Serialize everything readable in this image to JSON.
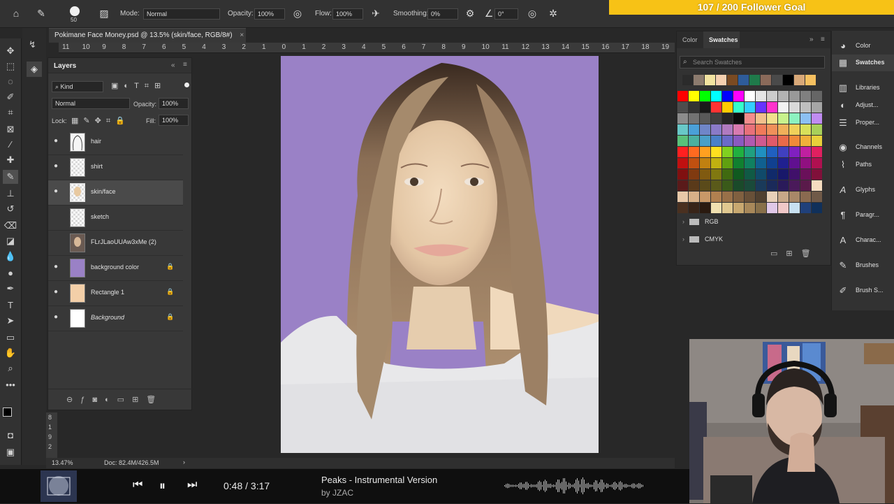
{
  "goal": {
    "text": "107 / 200 Follower Goal"
  },
  "options_bar": {
    "brush_size": "50",
    "mode_label": "Mode:",
    "mode_value": "Normal",
    "opacity_label": "Opacity:",
    "opacity_value": "100%",
    "flow_label": "Flow:",
    "flow_value": "100%",
    "smoothing_label": "Smoothing:",
    "smoothing_value": "0%",
    "angle_value": "0°"
  },
  "document": {
    "tab_title": "Pokimane Face Money.psd @ 13.5% (skin/face, RGB/8#)",
    "close_glyph": "×",
    "ruler_numbers": [
      "11",
      "10",
      "9",
      "8",
      "7",
      "6",
      "5",
      "4",
      "3",
      "2",
      "1",
      "0",
      "1",
      "2",
      "3",
      "4",
      "5",
      "6",
      "7",
      "8",
      "9",
      "10",
      "11",
      "12",
      "13",
      "14",
      "15",
      "16",
      "17",
      "18",
      "19"
    ],
    "vruler_numbers": [
      "8",
      "1",
      "9",
      "2"
    ],
    "zoom": "13.47%",
    "doc_size": "Doc: 82.4M/426.5M"
  },
  "layers_panel": {
    "title": "Layers",
    "kind_label": "Kind",
    "blend_mode": "Normal",
    "opacity_label": "Opacity:",
    "opacity_value": "100%",
    "lock_label": "Lock:",
    "fill_label": "Fill:",
    "fill_value": "100%",
    "layers": [
      {
        "name": "hair",
        "visible": true,
        "locked": false
      },
      {
        "name": "shirt",
        "visible": true,
        "locked": false
      },
      {
        "name": "skin/face",
        "visible": true,
        "locked": false,
        "selected": true
      },
      {
        "name": "sketch",
        "visible": false,
        "locked": false
      },
      {
        "name": "FLrJLaoUUAw3xMe (2)",
        "visible": false,
        "locked": false
      },
      {
        "name": "background color",
        "visible": true,
        "locked": true
      },
      {
        "name": "Rectangle 1",
        "visible": true,
        "locked": true
      },
      {
        "name": "Background",
        "visible": true,
        "locked": true
      }
    ]
  },
  "swatches_panel": {
    "tab_color": "Color",
    "tab_swatches": "Swatches",
    "search_placeholder": "Search Swatches",
    "groups": [
      "RGB",
      "CMYK"
    ],
    "recent": [
      "#2b2b2b",
      "#8c7b6e",
      "#f2e3a0",
      "#f5d0b0",
      "#7a4a22",
      "#2e5c9a",
      "#1f7a4a",
      "#8a6a5a",
      "#4a4a4a",
      "#000000",
      "#d8a878",
      "#f5c060"
    ],
    "grid": [
      "#ff0000",
      "#ffff00",
      "#00ff00",
      "#00ffff",
      "#0000ff",
      "#ff00ff",
      "#ffffff",
      "#e6e6e6",
      "#cccccc",
      "#b3b3b3",
      "#999999",
      "#808080",
      "#666666",
      "#4d4d4d",
      "#333333",
      "#1a1a1a",
      "#ff3333",
      "#ffcc00",
      "#33ffcc",
      "#33ccff",
      "#6633ff",
      "#ff33cc",
      "#f2f2f2",
      "#d9d9d9",
      "#bfbfbf",
      "#a6a6a6",
      "#8c8c8c",
      "#737373",
      "#595959",
      "#404040",
      "#262626",
      "#0d0d0d",
      "#f28c8c",
      "#f2c08c",
      "#f2e08c",
      "#c8f28c",
      "#8cf2c0",
      "#8cc0f2",
      "#c08cf2",
      "#68c8c8",
      "#4aa0d8",
      "#6f86c8",
      "#8a7ac8",
      "#b07ac0",
      "#d87ab0",
      "#e8707a",
      "#f07a5a",
      "#f0905a",
      "#f0b05a",
      "#f0d05a",
      "#d8e05a",
      "#a8d05a",
      "#5ac07a",
      "#4ab0a0",
      "#4aa0c8",
      "#4a80c8",
      "#6a6ac8",
      "#8a5ac0",
      "#b05ab0",
      "#d05a90",
      "#e05a6a",
      "#e86a4a",
      "#f08a3a",
      "#f0b03a",
      "#e8d03a",
      "#ff2020",
      "#ff6a20",
      "#ffa020",
      "#ffe020",
      "#80d020",
      "#20b040",
      "#20a080",
      "#2090c0",
      "#2060c0",
      "#4040c0",
      "#8020c0",
      "#c020a0",
      "#e02060",
      "#c01010",
      "#c05010",
      "#c08010",
      "#c0b010",
      "#60a010",
      "#108030",
      "#108060",
      "#106090",
      "#104090",
      "#202090",
      "#601090",
      "#901080",
      "#b01050",
      "#801010",
      "#803a10",
      "#805a10",
      "#807810",
      "#406a10",
      "#105a20",
      "#105a45",
      "#104a6a",
      "#102a6a",
      "#18186a",
      "#40106a",
      "#6a105a",
      "#80103a",
      "#5a1a1a",
      "#5a3a1a",
      "#5a4a1a",
      "#5a5a1a",
      "#3a5a1a",
      "#1a4a2a",
      "#1a4a3a",
      "#1a3a5a",
      "#1a2a5a",
      "#2a1a5a",
      "#4a1a5a",
      "#5a1a4a",
      "#f5dcc0",
      "#e8c8a8",
      "#d8b088",
      "#c89868",
      "#b08050",
      "#987048",
      "#806040",
      "#685038",
      "#504030",
      "#e8d0b8",
      "#c8a888",
      "#a88868",
      "#8a6a50",
      "#705a48",
      "#4a3020",
      "#382418",
      "#2a1a10",
      "#f0e0b0",
      "#e0c890",
      "#c8a870",
      "#a8885a",
      "#88704a",
      "#e0c8e8",
      "#f0c8c8",
      "#c8e0f0",
      "#20407a",
      "#10305a"
    ]
  },
  "dock": {
    "items": [
      "Color",
      "Swatches",
      "Libraries",
      "Adjust...",
      "Proper...",
      "Channels",
      "Paths",
      "Glyphs",
      "Paragr...",
      "Charac...",
      "Brushes",
      "Brush S..."
    ]
  },
  "media": {
    "time": "0:48 / 3:17",
    "title": "Peaks - Instrumental Version",
    "artist": "by JZAC"
  },
  "colors": {
    "canvas_bg": "#9a81c6",
    "goal_bar": "#f7c216",
    "panel": "#383838",
    "selected_layer": "#4a4a4a"
  }
}
